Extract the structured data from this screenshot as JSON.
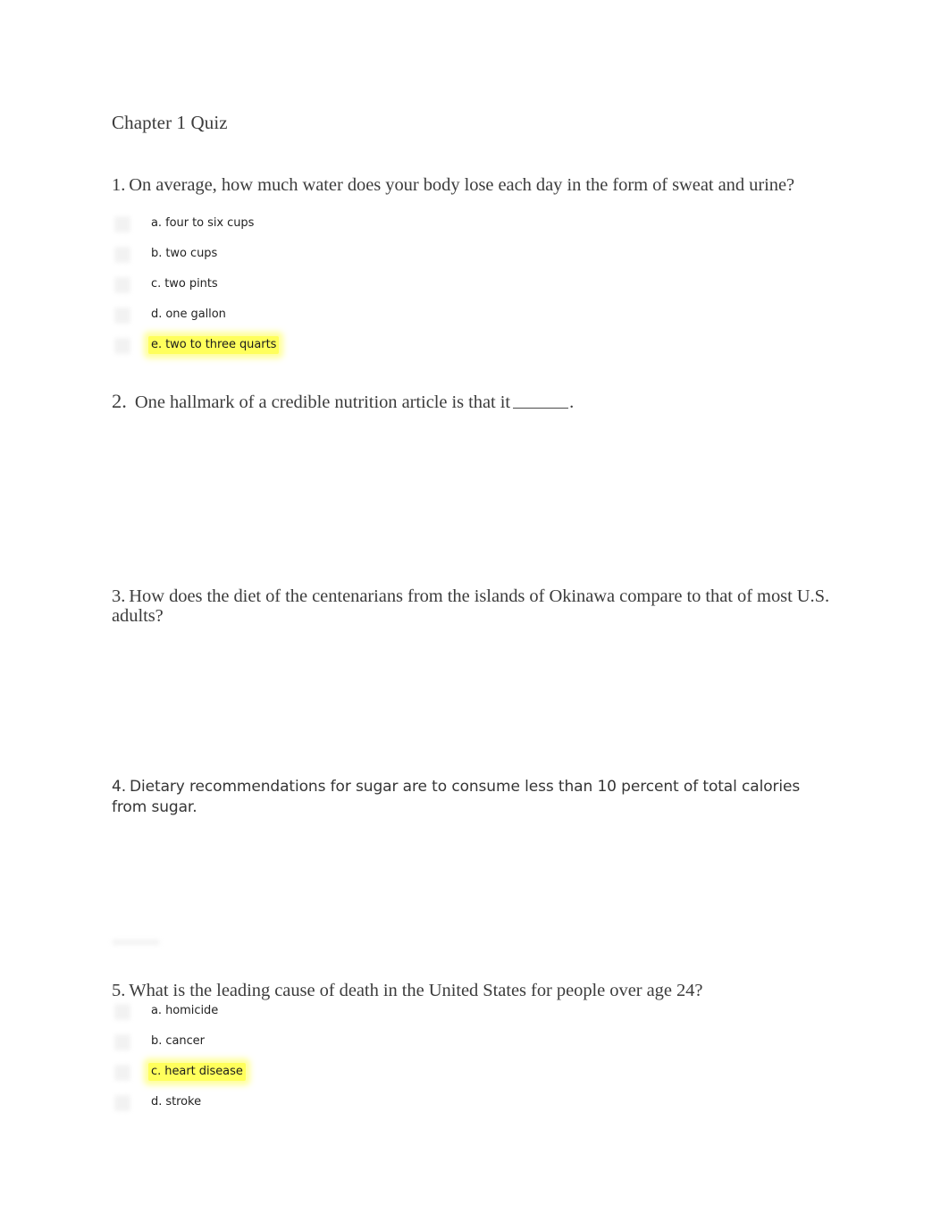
{
  "document": {
    "title": "Chapter 1 Quiz"
  },
  "questions": [
    {
      "number": "1.",
      "stem": "On average, how much water does your body lose each day in the form of sweat and urine?",
      "style": "serif",
      "options": [
        {
          "label": "a. four to six cups",
          "highlighted": false
        },
        {
          "label": "b. two cups",
          "highlighted": false
        },
        {
          "label": "c. two pints",
          "highlighted": false
        },
        {
          "label": "d. one gallon",
          "highlighted": false
        },
        {
          "label": "e. two to three quarts",
          "highlighted": true
        }
      ]
    },
    {
      "number": "2.",
      "stem_before_blank": "One hallmark of a credible nutrition article is that it",
      "stem_after_blank": ".",
      "style": "serif",
      "options": []
    },
    {
      "number": "3.",
      "stem": "How does the diet of the centenarians from the islands of Okinawa compare to that of most U.S. adults?",
      "style": "serif",
      "options": []
    },
    {
      "number": "4.",
      "stem": "Dietary recommendations for sugar are to consume less than 10 percent of total calories from sugar.",
      "style": "sans",
      "options": []
    },
    {
      "number": "5.",
      "stem": "What is the leading cause of death in the United States for people over age 24?",
      "style": "serif",
      "options": [
        {
          "label": "a. homicide",
          "highlighted": false
        },
        {
          "label": "b. cancer",
          "highlighted": false
        },
        {
          "label": "c. heart disease",
          "highlighted": true
        },
        {
          "label": "d. stroke",
          "highlighted": false
        }
      ]
    }
  ],
  "colors": {
    "highlight": "#ffff5c",
    "text": "#3c3c3c",
    "sans_text": "#353535",
    "option_text": "#232323",
    "radio_placeholder": "#f2f2f2",
    "page_background": "#ffffff"
  }
}
